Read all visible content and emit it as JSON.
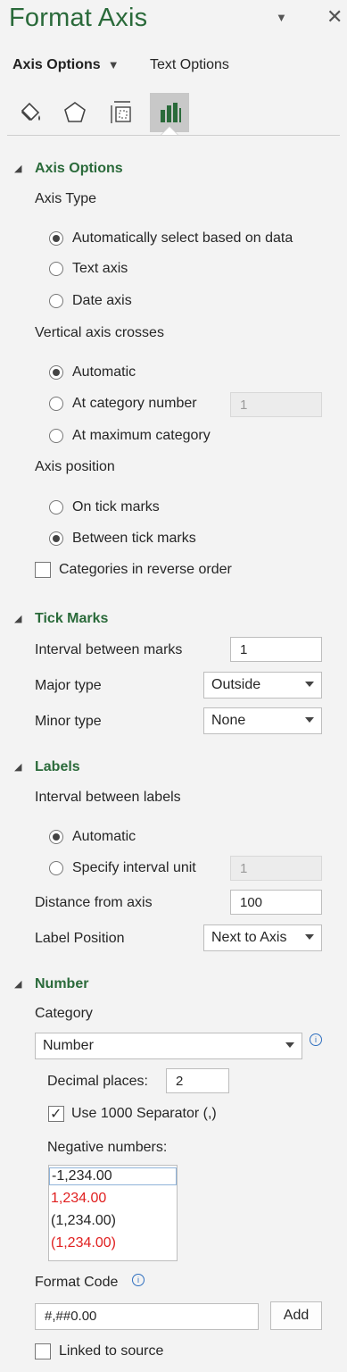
{
  "pane": {
    "title": "Format Axis",
    "close_glyph": "✕",
    "tabs": [
      {
        "label": "Axis Options",
        "active": true
      },
      {
        "label": "Text Options",
        "active": false
      }
    ],
    "icons": [
      "fill-line-icon",
      "effects-icon",
      "size-properties-icon",
      "axis-options-icon"
    ]
  },
  "axis_options": {
    "title": "Axis Options",
    "axis_type_label": "Axis Type",
    "axis_type_options": [
      "Automatically select based on data",
      "Text axis",
      "Date axis"
    ],
    "axis_type_selected": 0,
    "vertical_crosses_label": "Vertical axis crosses",
    "crosses_options": [
      "Automatic",
      "At category number",
      "At maximum category"
    ],
    "crosses_selected": 0,
    "category_number_value": "1",
    "axis_position_label": "Axis position",
    "position_options": [
      "On tick marks",
      "Between tick marks"
    ],
    "position_selected": 1,
    "reverse_label": "Categories in reverse order",
    "reverse_checked": false
  },
  "tick_marks": {
    "title": "Tick Marks",
    "interval_label": "Interval between marks",
    "interval_value": "1",
    "major_label": "Major type",
    "major_value": "Outside",
    "minor_label": "Minor type",
    "minor_value": "None"
  },
  "labels": {
    "title": "Labels",
    "interval_label": "Interval between labels",
    "options": [
      "Automatic",
      "Specify interval unit"
    ],
    "selected": 0,
    "interval_unit_value": "1",
    "distance_label": "Distance from axis",
    "distance_value": "100",
    "position_label": "Label Position",
    "position_value": "Next to Axis"
  },
  "number": {
    "title": "Number",
    "category_label": "Category",
    "category_value": "Number",
    "decimal_label": "Decimal places:",
    "decimal_value": "2",
    "separator_label": "Use 1000 Separator (,)",
    "separator_checked": true,
    "negative_label": "Negative numbers:",
    "negative_options": [
      {
        "text": "-1,234.00",
        "color": "#262626"
      },
      {
        "text": "1,234.00",
        "color": "#e02020"
      },
      {
        "text": "(1,234.00)",
        "color": "#262626"
      },
      {
        "text": "(1,234.00)",
        "color": "#e02020"
      }
    ],
    "format_code_label": "Format Code",
    "format_code_value": "#,##0.00",
    "add_label": "Add",
    "linked_label": "Linked to source",
    "linked_checked": false
  },
  "colors": {
    "accent": "#2a6a3a",
    "negative_red": "#e02020",
    "link_blue": "#2f6fbf"
  }
}
